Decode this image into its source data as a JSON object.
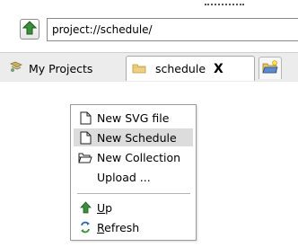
{
  "address": {
    "value": "project://schedule/"
  },
  "tabs": [
    {
      "label": "My Projects",
      "icon": "projects-icon",
      "active": false
    },
    {
      "label": "schedule",
      "icon": "folder-icon",
      "active": true,
      "close": "X"
    },
    {
      "icon": "new-tab-folder-icon"
    }
  ],
  "menu": {
    "items": [
      {
        "label": "New SVG file",
        "icon": "document-icon"
      },
      {
        "label": "New Schedule",
        "icon": "document-icon",
        "highlighted": true
      },
      {
        "label": "New Collection",
        "icon": "open-folder-icon"
      },
      {
        "label": "Upload ..."
      },
      {
        "mnemonic": "U",
        "rest": "p",
        "icon": "up-arrow-icon"
      },
      {
        "mnemonic": "R",
        "rest": "efresh",
        "icon": "refresh-icon"
      }
    ]
  },
  "colors": {
    "highlight": "#dcdcdc",
    "arrow_green": "#2e7d32"
  }
}
